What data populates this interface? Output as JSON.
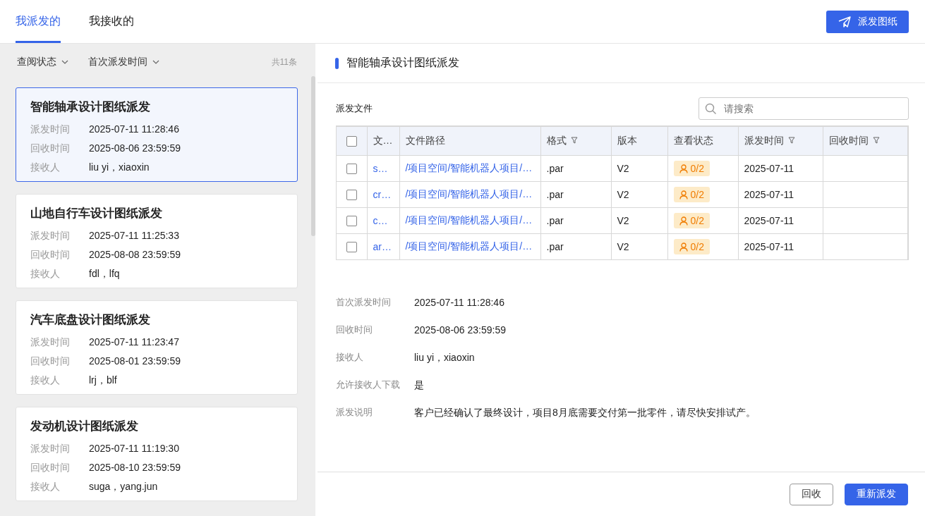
{
  "tabs": [
    {
      "label": "我派发的",
      "selected": true
    },
    {
      "label": "我接收的",
      "selected": false
    }
  ],
  "send_button": {
    "label": "派发图纸"
  },
  "filters": [
    {
      "label": "查阅状态"
    },
    {
      "label": "首次派发时间"
    }
  ],
  "count": "共11条",
  "cards": [
    {
      "title": "智能轴承设计图纸派发",
      "selected": true,
      "fields": [
        {
          "label": "派发时间",
          "value": "2025-07-11 11:28:46"
        },
        {
          "label": "回收时间",
          "value": "2025-08-06 23:59:59"
        },
        {
          "label": "接收人",
          "value": "liu yi，xiaoxin"
        }
      ]
    },
    {
      "title": "山地自行车设计图纸派发",
      "selected": false,
      "fields": [
        {
          "label": "派发时间",
          "value": "2025-07-11 11:25:33"
        },
        {
          "label": "回收时间",
          "value": "2025-08-08 23:59:59"
        },
        {
          "label": "接收人",
          "value": "fdl，lfq"
        }
      ]
    },
    {
      "title": "汽车底盘设计图纸派发",
      "selected": false,
      "fields": [
        {
          "label": "派发时间",
          "value": "2025-07-11 11:23:47"
        },
        {
          "label": "回收时间",
          "value": "2025-08-01 23:59:59"
        },
        {
          "label": "接收人",
          "value": "lrj，blf"
        }
      ]
    },
    {
      "title": "发动机设计图纸派发",
      "selected": false,
      "fields": [
        {
          "label": "派发时间",
          "value": "2025-07-11 11:19:30"
        },
        {
          "label": "回收时间",
          "value": "2025-08-10 23:59:59"
        },
        {
          "label": "接收人",
          "value": "suga，yang.jun"
        }
      ]
    }
  ],
  "detail": {
    "title": "智能轴承设计图纸派发",
    "files_label": "派发文件",
    "search": {
      "placeholder": "请搜索"
    },
    "table": {
      "header_checked": false,
      "columns": [
        {
          "label": "文…",
          "filter": false
        },
        {
          "label": "文件路径",
          "filter": false
        },
        {
          "label": "格式",
          "filter": true
        },
        {
          "label": "版本",
          "filter": false
        },
        {
          "label": "查看状态",
          "filter": false
        },
        {
          "label": "派发时间",
          "filter": true
        },
        {
          "label": "回收时间",
          "filter": true
        }
      ],
      "rows": [
        {
          "checked": false,
          "name": "s…",
          "path": "/项目空间/智能机器人项目/…",
          "format": ".par",
          "version": "V2",
          "status": "0/2",
          "date": "2025-07-11"
        },
        {
          "checked": false,
          "name": "cr…",
          "path": "/项目空间/智能机器人项目/…",
          "format": ".par",
          "version": "V2",
          "status": "0/2",
          "date": "2025-07-11"
        },
        {
          "checked": false,
          "name": "c…",
          "path": "/项目空间/智能机器人项目/…",
          "format": ".par",
          "version": "V2",
          "status": "0/2",
          "date": "2025-07-11"
        },
        {
          "checked": false,
          "name": "ar…",
          "path": "/项目空间/智能机器人项目/…",
          "format": ".par",
          "version": "V2",
          "status": "0/2",
          "date": "2025-07-11"
        }
      ]
    },
    "info": [
      {
        "label": "首次派发时间",
        "value": "2025-07-11 11:28:46"
      },
      {
        "label": "回收时间",
        "value": "2025-08-06 23:59:59"
      },
      {
        "label": "接收人",
        "value": "liu yi，xiaoxin"
      },
      {
        "label": "允许接收人下载",
        "value": "是"
      },
      {
        "label": "派发说明",
        "value": "客户已经确认了最终设计，项目8月底需要交付第一批零件，请尽快安排试产。"
      }
    ],
    "buttons": [
      {
        "label": "回收",
        "kind": "secondary"
      },
      {
        "label": "重新派发",
        "kind": "primary"
      }
    ]
  }
}
